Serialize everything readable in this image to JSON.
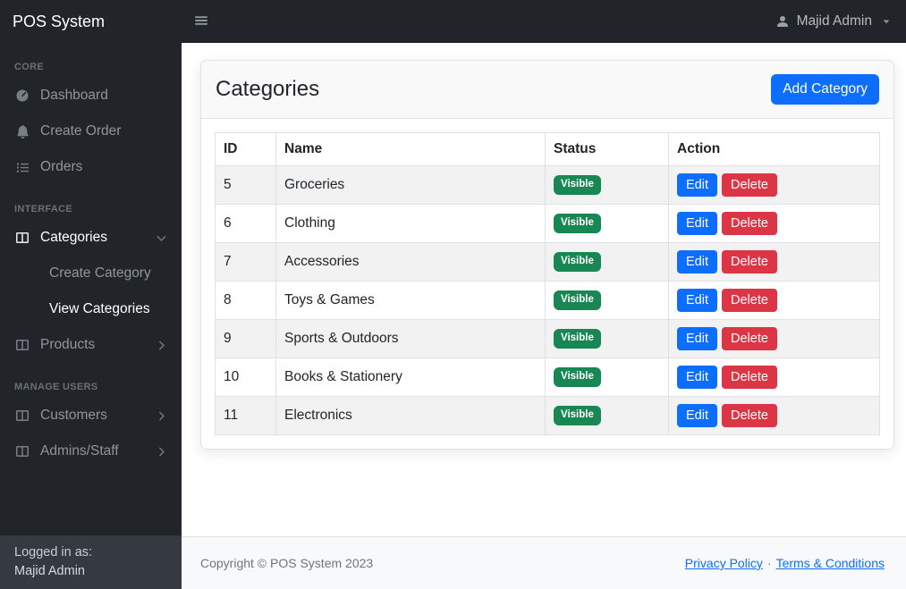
{
  "topbar": {
    "brand": "POS System",
    "user": {
      "name": "Majid Admin"
    }
  },
  "sidebar": {
    "sections": [
      {
        "heading": "CORE",
        "items": [
          {
            "label": "Dashboard",
            "icon": "tachometer-icon"
          },
          {
            "label": "Create Order",
            "icon": "bell-icon"
          },
          {
            "label": "Orders",
            "icon": "list-icon"
          }
        ]
      },
      {
        "heading": "INTERFACE",
        "items": [
          {
            "label": "Categories",
            "icon": "columns-icon",
            "expanded": true,
            "submenu": [
              {
                "label": "Create Category"
              },
              {
                "label": "View Categories",
                "active": true
              }
            ]
          },
          {
            "label": "Products",
            "icon": "columns-icon"
          }
        ]
      },
      {
        "heading": "MANAGE USERS",
        "items": [
          {
            "label": "Customers",
            "icon": "columns-icon"
          },
          {
            "label": "Admins/Staff",
            "icon": "columns-icon"
          }
        ]
      }
    ],
    "footer": {
      "line1": "Logged in as:",
      "line2": "Majid Admin"
    }
  },
  "card": {
    "title": "Categories",
    "add_button": "Add Category"
  },
  "table": {
    "columns": [
      "ID",
      "Name",
      "Status",
      "Action"
    ],
    "rows": [
      {
        "id": "5",
        "name": "Groceries",
        "status": "Visible"
      },
      {
        "id": "6",
        "name": "Clothing",
        "status": "Visible"
      },
      {
        "id": "7",
        "name": "Accessories",
        "status": "Visible"
      },
      {
        "id": "8",
        "name": "Toys & Games",
        "status": "Visible"
      },
      {
        "id": "9",
        "name": "Sports & Outdoors",
        "status": "Visible"
      },
      {
        "id": "10",
        "name": "Books & Stationery",
        "status": "Visible"
      },
      {
        "id": "11",
        "name": "Electronics",
        "status": "Visible"
      }
    ],
    "actions": {
      "edit": "Edit",
      "delete": "Delete"
    }
  },
  "footer": {
    "copyright": "Copyright © POS System 2023",
    "links": [
      {
        "label": "Privacy Policy"
      },
      {
        "label": "Terms & Conditions"
      }
    ],
    "separator": "·"
  },
  "colors": {
    "topbar_bg": "#212529",
    "sidebar_bg": "#212529",
    "sidebar_footer_bg": "#343a40",
    "primary": "#0d6efd",
    "success": "#198754",
    "danger": "#dc3545",
    "footer_bg": "#f8f9fa"
  }
}
